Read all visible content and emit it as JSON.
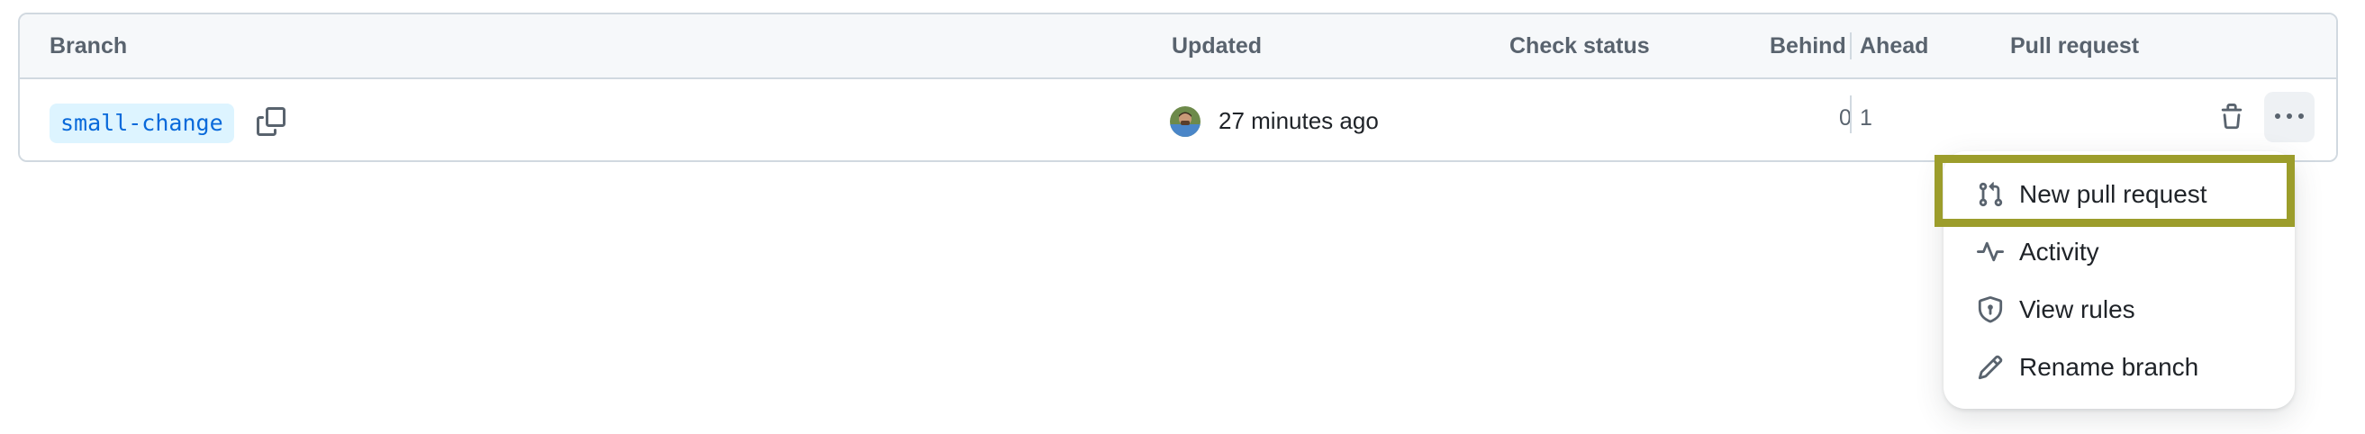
{
  "table": {
    "headers": {
      "branch": "Branch",
      "updated": "Updated",
      "check_status": "Check status",
      "behind": "Behind",
      "ahead": "Ahead",
      "pull_request": "Pull request"
    },
    "rows": [
      {
        "branch_name": "small-change",
        "updated": "27 minutes ago",
        "behind": "0",
        "ahead": "1",
        "pull_request": ""
      }
    ]
  },
  "icons": {
    "copy": "copy-icon",
    "delete": "trash-icon",
    "more": "kebab-horizontal-icon"
  },
  "menu": {
    "items": [
      {
        "label": "New pull request",
        "icon": "git-pull-request-icon",
        "highlighted": true
      },
      {
        "label": "Activity",
        "icon": "pulse-icon"
      },
      {
        "label": "View rules",
        "icon": "shield-lock-icon"
      },
      {
        "label": "Rename branch",
        "icon": "pencil-icon"
      }
    ]
  },
  "colors": {
    "branch_pill_bg": "#ddf4ff",
    "branch_pill_text": "#0969da",
    "highlight_border": "#9c9d2b",
    "header_bg": "#f6f8fa"
  }
}
